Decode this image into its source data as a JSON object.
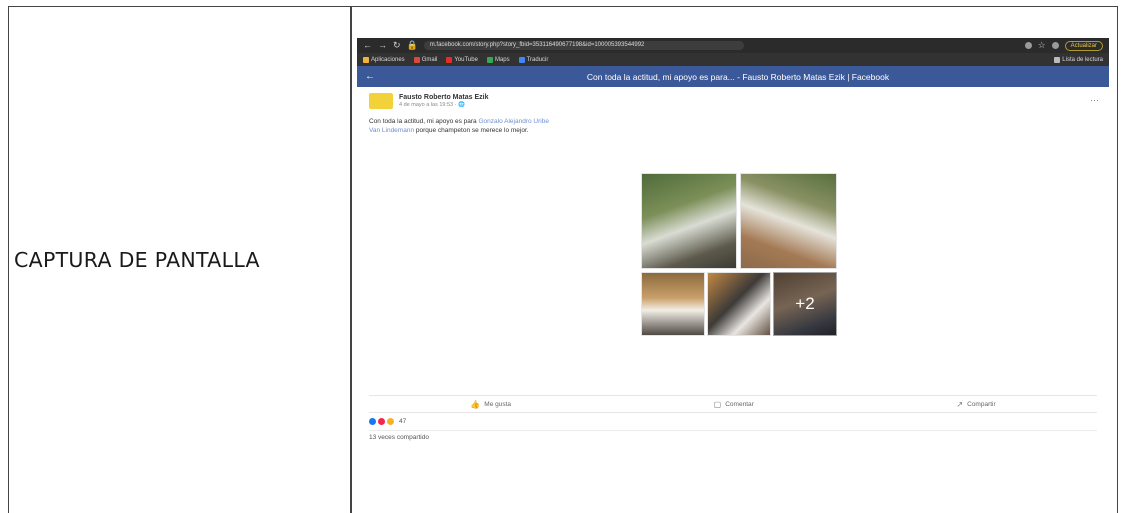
{
  "document": {
    "left_label": "CAPTURA DE PANTALLA"
  },
  "browser": {
    "url": "m.facebook.com/story.php?story_fbid=353116490677198&id=100005393544992",
    "upgrade_label": "Actualizar",
    "bookmarks": [
      {
        "label": "Aplicaciones",
        "color": "#f2b33d"
      },
      {
        "label": "Gmail",
        "color": "#d9493c"
      },
      {
        "label": "YouTube",
        "color": "#e52d27"
      },
      {
        "label": "Maps",
        "color": "#34a853"
      },
      {
        "label": "Traducir",
        "color": "#4285f4"
      }
    ],
    "reading_list": "Lista de lectura"
  },
  "facebook": {
    "header_title": "Con toda la actitud, mi apoyo es para... - Fausto Roberto Matas Ezik | Facebook",
    "post": {
      "author": "Fausto Roberto Matas Ezik",
      "time": "4 de mayo a las 19:53 · 🌐",
      "text_start": "Con toda la actitud, mi apoyo es para ",
      "mention": "Gonzalo Alejandro Uribe",
      "text_line2_link": "Van Lindemann",
      "text_line2": " porque champeton se merece lo mejor.",
      "more_photos": "+2"
    },
    "actions": {
      "like": "Me gusta",
      "comment": "Comentar",
      "share": "Compartir"
    },
    "reactions": {
      "count": "47",
      "colors": [
        "#1877f2",
        "#f0284a",
        "#f7b125"
      ]
    },
    "shares": "13 veces compartido"
  }
}
